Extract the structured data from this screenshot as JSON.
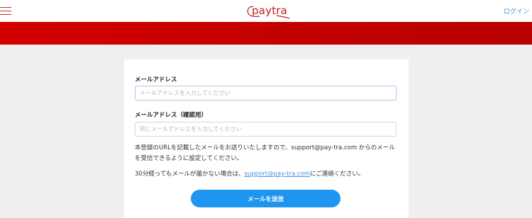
{
  "header": {
    "logo_text": "paytra",
    "login_label": "ログイン"
  },
  "form": {
    "email_label": "メールアドレス",
    "email_placeholder": "メールアドレスを入力してください",
    "confirm_label": "メールアドレス（確認用）",
    "confirm_placeholder": "同じメールアドレスを入力してください",
    "note1": "本登録のURLを記載したメールをお送りいたしますので、support@pay-tra.com からのメールを受信できるように設定してください。",
    "note2_prefix": "30分経ってもメールが届かない場合は、",
    "note2_link": "support@pay-tra.com",
    "note2_suffix": "にご連絡ください。",
    "submit_label": "メールを送信"
  },
  "colors": {
    "brand_red": "#c01f1f",
    "banner_red": "#c80000",
    "link_blue": "#4a90d9",
    "button_blue": "#1e95f0"
  },
  "icons": {
    "menu": "hamburger-menu-icon",
    "logo": "paytra-logo"
  }
}
